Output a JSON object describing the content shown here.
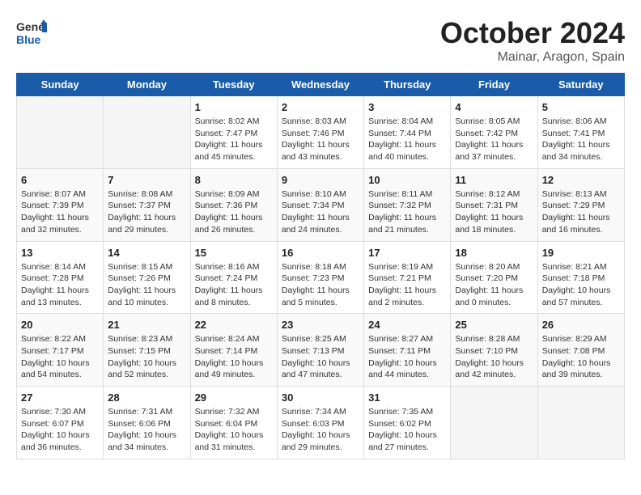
{
  "header": {
    "logo_line1": "General",
    "logo_line2": "Blue",
    "month_year": "October 2024",
    "location": "Mainar, Aragon, Spain"
  },
  "weekdays": [
    "Sunday",
    "Monday",
    "Tuesday",
    "Wednesday",
    "Thursday",
    "Friday",
    "Saturday"
  ],
  "weeks": [
    [
      null,
      null,
      {
        "day": 1,
        "sunrise": "8:02 AM",
        "sunset": "7:47 PM",
        "daylight": "11 hours and 45 minutes."
      },
      {
        "day": 2,
        "sunrise": "8:03 AM",
        "sunset": "7:46 PM",
        "daylight": "11 hours and 43 minutes."
      },
      {
        "day": 3,
        "sunrise": "8:04 AM",
        "sunset": "7:44 PM",
        "daylight": "11 hours and 40 minutes."
      },
      {
        "day": 4,
        "sunrise": "8:05 AM",
        "sunset": "7:42 PM",
        "daylight": "11 hours and 37 minutes."
      },
      {
        "day": 5,
        "sunrise": "8:06 AM",
        "sunset": "7:41 PM",
        "daylight": "11 hours and 34 minutes."
      }
    ],
    [
      {
        "day": 6,
        "sunrise": "8:07 AM",
        "sunset": "7:39 PM",
        "daylight": "11 hours and 32 minutes."
      },
      {
        "day": 7,
        "sunrise": "8:08 AM",
        "sunset": "7:37 PM",
        "daylight": "11 hours and 29 minutes."
      },
      {
        "day": 8,
        "sunrise": "8:09 AM",
        "sunset": "7:36 PM",
        "daylight": "11 hours and 26 minutes."
      },
      {
        "day": 9,
        "sunrise": "8:10 AM",
        "sunset": "7:34 PM",
        "daylight": "11 hours and 24 minutes."
      },
      {
        "day": 10,
        "sunrise": "8:11 AM",
        "sunset": "7:32 PM",
        "daylight": "11 hours and 21 minutes."
      },
      {
        "day": 11,
        "sunrise": "8:12 AM",
        "sunset": "7:31 PM",
        "daylight": "11 hours and 18 minutes."
      },
      {
        "day": 12,
        "sunrise": "8:13 AM",
        "sunset": "7:29 PM",
        "daylight": "11 hours and 16 minutes."
      }
    ],
    [
      {
        "day": 13,
        "sunrise": "8:14 AM",
        "sunset": "7:28 PM",
        "daylight": "11 hours and 13 minutes."
      },
      {
        "day": 14,
        "sunrise": "8:15 AM",
        "sunset": "7:26 PM",
        "daylight": "11 hours and 10 minutes."
      },
      {
        "day": 15,
        "sunrise": "8:16 AM",
        "sunset": "7:24 PM",
        "daylight": "11 hours and 8 minutes."
      },
      {
        "day": 16,
        "sunrise": "8:18 AM",
        "sunset": "7:23 PM",
        "daylight": "11 hours and 5 minutes."
      },
      {
        "day": 17,
        "sunrise": "8:19 AM",
        "sunset": "7:21 PM",
        "daylight": "11 hours and 2 minutes."
      },
      {
        "day": 18,
        "sunrise": "8:20 AM",
        "sunset": "7:20 PM",
        "daylight": "11 hours and 0 minutes."
      },
      {
        "day": 19,
        "sunrise": "8:21 AM",
        "sunset": "7:18 PM",
        "daylight": "10 hours and 57 minutes."
      }
    ],
    [
      {
        "day": 20,
        "sunrise": "8:22 AM",
        "sunset": "7:17 PM",
        "daylight": "10 hours and 54 minutes."
      },
      {
        "day": 21,
        "sunrise": "8:23 AM",
        "sunset": "7:15 PM",
        "daylight": "10 hours and 52 minutes."
      },
      {
        "day": 22,
        "sunrise": "8:24 AM",
        "sunset": "7:14 PM",
        "daylight": "10 hours and 49 minutes."
      },
      {
        "day": 23,
        "sunrise": "8:25 AM",
        "sunset": "7:13 PM",
        "daylight": "10 hours and 47 minutes."
      },
      {
        "day": 24,
        "sunrise": "8:27 AM",
        "sunset": "7:11 PM",
        "daylight": "10 hours and 44 minutes."
      },
      {
        "day": 25,
        "sunrise": "8:28 AM",
        "sunset": "7:10 PM",
        "daylight": "10 hours and 42 minutes."
      },
      {
        "day": 26,
        "sunrise": "8:29 AM",
        "sunset": "7:08 PM",
        "daylight": "10 hours and 39 minutes."
      }
    ],
    [
      {
        "day": 27,
        "sunrise": "7:30 AM",
        "sunset": "6:07 PM",
        "daylight": "10 hours and 36 minutes."
      },
      {
        "day": 28,
        "sunrise": "7:31 AM",
        "sunset": "6:06 PM",
        "daylight": "10 hours and 34 minutes."
      },
      {
        "day": 29,
        "sunrise": "7:32 AM",
        "sunset": "6:04 PM",
        "daylight": "10 hours and 31 minutes."
      },
      {
        "day": 30,
        "sunrise": "7:34 AM",
        "sunset": "6:03 PM",
        "daylight": "10 hours and 29 minutes."
      },
      {
        "day": 31,
        "sunrise": "7:35 AM",
        "sunset": "6:02 PM",
        "daylight": "10 hours and 27 minutes."
      },
      null,
      null
    ]
  ]
}
